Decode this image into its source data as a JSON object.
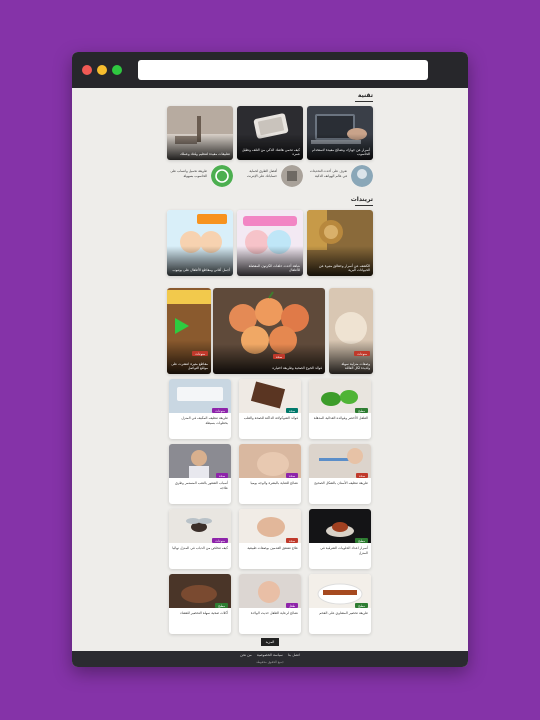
{
  "browser": {
    "url": ""
  },
  "sections": {
    "tech": {
      "title": "تقنية"
    },
    "trends": {
      "title": "تريندات"
    }
  },
  "tech_cards": [
    "أسرار عن جهازك ونصائح مفيدة لاستخدام الحاسوب",
    "كيف تحمي هاتفك الذكي من التلف وتطيل عمره",
    "تطبيقات مفيدة لتنظيم وقتك وعملك"
  ],
  "tech_mini": [
    "تعرف على أحدث التحديثات في عالم الهواتف الذكية",
    "أفضل الطرق لحماية حساباتك على الإنترنت",
    "طريقة تحميل واتساب على الحاسوب بسهولة"
  ],
  "trend_cards": [
    "الكشف عن أسرار وحقائق مثيرة عن الحيوانات البرية",
    "شاهد أحدث حلقات الكرتون المفضلة للأطفال",
    "أجمل أغاني ومقاطع الأطفال على يوتيوب"
  ],
  "featured": [
    "وصفات منزلية سهلة ولذيذة لكل العائلة",
    "فوائد الخوخ الصحية وطريقة اختياره",
    "مقاطع مثيرة انتشرت على مواقع التواصل"
  ],
  "grid": [
    "طريقة تنظيف المكيف في المنزل بخطوات بسيطة",
    "فوائد الشوكولاتة الداكنة للصحة والقلب",
    "الفلفل الأخضر وفوائده الغذائية المذهلة",
    "أسباب الشعور بالتعب المستمر وطرق علاجه",
    "نصائح للعناية بالبشرة والوجه يوميا",
    "طريقة تنظيف الأسنان بالشكل الصحيح",
    "كيف تتخلص من الذباب في المنزل نهائيا",
    "علاج تشقق القدمين بوصفات طبيعية",
    "أسرار اعداد الحلويات الشرقية في المنزل",
    "أكلات صحية سهلة التحضير للعشاء",
    "نصائح لرعاية الطفل حديث الولادة",
    "طريقة تحضير المشاوي على الفحم"
  ],
  "badges": [
    "منوعات",
    "صحة",
    "مطبخ",
    "طفل"
  ],
  "more_button": "المزيد",
  "footer": {
    "links": [
      "اتصل بنا",
      "سياسة الخصوصية",
      "من نحن"
    ],
    "copyright": "جميع الحقوق محفوظة"
  },
  "colors": {
    "background": "#8533a8",
    "page": "#eeedea",
    "titlebar": "#27272b",
    "footer": "#2b2b30",
    "badge_red": "#c0392b",
    "badge_green": "#2e7d32",
    "badge_purple": "#8e24aa",
    "badge_teal": "#00796b"
  }
}
